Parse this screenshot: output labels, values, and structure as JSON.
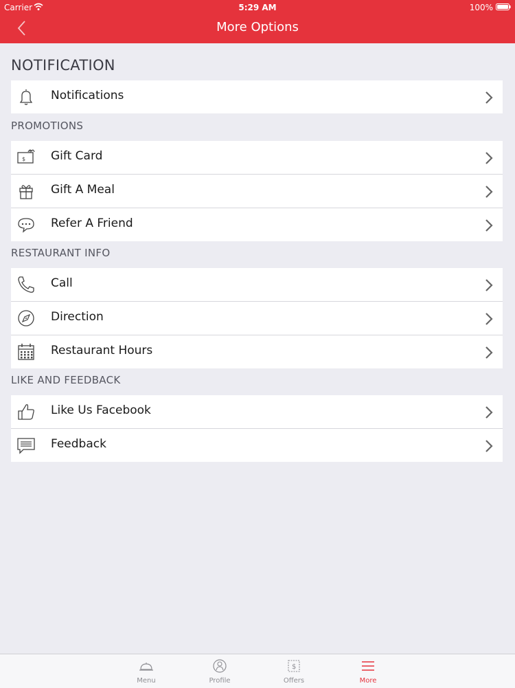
{
  "status_bar": {
    "carrier": "Carrier",
    "time": "5:29 AM",
    "battery": "100%"
  },
  "nav": {
    "title": "More Options",
    "back_icon": "chevron-left-icon"
  },
  "sections": {
    "notification": {
      "title": "NOTIFICATION",
      "items": [
        {
          "label": "Notifications",
          "icon": "bell-icon"
        }
      ]
    },
    "promotions": {
      "title": "PROMOTIONS",
      "items": [
        {
          "label": "Gift Card",
          "icon": "gift-card-icon"
        },
        {
          "label": "Gift A Meal",
          "icon": "gift-icon"
        },
        {
          "label": "Refer A Friend",
          "icon": "chat-bubbles-icon"
        }
      ]
    },
    "restaurant_info": {
      "title": "RESTAURANT INFO",
      "items": [
        {
          "label": "Call",
          "icon": "phone-icon"
        },
        {
          "label": "Direction",
          "icon": "compass-icon"
        },
        {
          "label": "Restaurant Hours",
          "icon": "calendar-icon"
        }
      ]
    },
    "like_feedback": {
      "title": "LIKE AND FEEDBACK",
      "items": [
        {
          "label": "Like Us Facebook",
          "icon": "thumbs-up-icon"
        },
        {
          "label": "Feedback",
          "icon": "message-icon"
        }
      ]
    }
  },
  "tabs": [
    {
      "label": "Menu",
      "icon": "cloche-icon",
      "active": false
    },
    {
      "label": "Profile",
      "icon": "person-icon",
      "active": false
    },
    {
      "label": "Offers",
      "icon": "coupon-icon",
      "active": false
    },
    {
      "label": "More",
      "icon": "hamburger-icon",
      "active": true
    }
  ],
  "colors": {
    "brand": "#e5333c",
    "background": "#ececf2",
    "tab_inactive": "#8e8e93"
  }
}
